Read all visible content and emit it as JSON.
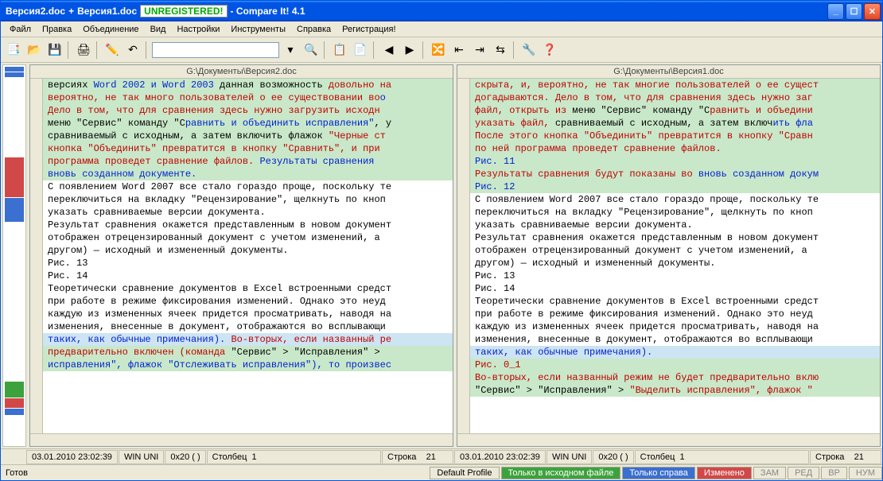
{
  "title": {
    "a": "Версия2.doc",
    "plus": "+",
    "b": "Версия1.doc",
    "dash": "- Compare It! 4.1",
    "unreg": "UNREGISTERED!"
  },
  "menu": [
    "Файл",
    "Правка",
    "Объединение",
    "Вид",
    "Настройки",
    "Инструменты",
    "Справка",
    "Регистрация!"
  ],
  "left": {
    "path": "G:\\Документы\\Версия2.doc",
    "lines": [
      {
        "cls": "bg-change",
        "spans": [
          {
            "c": "c-black",
            "t": "версиях "
          },
          {
            "c": "c-blue",
            "t": "Word 2002 и Word 2003 "
          },
          {
            "c": "c-black",
            "t": "данная возможность "
          },
          {
            "c": "c-red",
            "t": "довольно на"
          }
        ]
      },
      {
        "cls": "bg-change",
        "spans": [
          {
            "c": "c-red",
            "t": "вероятно, не так много пользователей о ее существовании во"
          },
          {
            "c": "c-blue",
            "t": "о"
          }
        ]
      },
      {
        "cls": "bg-change",
        "spans": [
          {
            "c": "c-red",
            "t": "Дело в том, что для сравнения здесь нужно загрузить исходн"
          }
        ]
      },
      {
        "cls": "bg-change",
        "spans": [
          {
            "c": "c-black",
            "t": "меню \"Сервис\" команду \"С"
          },
          {
            "c": "c-blue",
            "t": "равнить и объединить исправления\""
          },
          {
            "c": "c-black",
            "t": ", у"
          }
        ]
      },
      {
        "cls": "bg-change",
        "spans": [
          {
            "c": "c-black",
            "t": "сравниваемый с исходным, а затем включить флажок "
          },
          {
            "c": "c-red",
            "t": "\"Черные ст"
          }
        ]
      },
      {
        "cls": "bg-change",
        "spans": [
          {
            "c": "c-red",
            "t": "кнопка \"Объединить\" превратится в кнопку \"Сравнить\", и при "
          }
        ]
      },
      {
        "cls": "bg-change",
        "spans": [
          {
            "c": "c-red",
            "t": "программа проведет сравнение файлов. "
          },
          {
            "c": "c-blue",
            "t": " Результаты сравнения "
          }
        ]
      },
      {
        "cls": "bg-change",
        "spans": [
          {
            "c": "c-blue",
            "t": "вновь созданном документе."
          }
        ]
      },
      {
        "cls": "bg-del",
        "spans": [
          {
            "c": "c-black",
            "t": " "
          }
        ]
      },
      {
        "cls": "bg-del",
        "spans": [
          {
            "c": "c-black",
            "t": " "
          }
        ]
      },
      {
        "cls": "",
        "spans": [
          {
            "c": "c-black",
            "t": "С появлением Word 2007 все стало гораздо проще, поскольку те"
          }
        ]
      },
      {
        "cls": "",
        "spans": [
          {
            "c": "c-black",
            "t": "переключиться на вкладку \"Рецензирование\", щелкнуть по кноп"
          }
        ]
      },
      {
        "cls": "",
        "spans": [
          {
            "c": "c-black",
            "t": "указать сравниваемые версии документа."
          }
        ]
      },
      {
        "cls": "",
        "spans": [
          {
            "c": "c-black",
            "t": "Результат сравнения окажется представленным в новом документ"
          }
        ]
      },
      {
        "cls": "",
        "spans": [
          {
            "c": "c-black",
            "t": "отображен отрецензированный документ с учетом изменений, а "
          }
        ]
      },
      {
        "cls": "",
        "spans": [
          {
            "c": "c-black",
            "t": "другом) — исходный и измененный документы."
          }
        ]
      },
      {
        "cls": "",
        "spans": [
          {
            "c": "c-black",
            "t": "Рис. 13"
          }
        ]
      },
      {
        "cls": "",
        "spans": [
          {
            "c": "c-black",
            "t": "Рис. 14"
          }
        ]
      },
      {
        "cls": "",
        "spans": [
          {
            "c": "c-black",
            "t": "Теоретически сравнение документов в Excel встроенными средст"
          }
        ]
      },
      {
        "cls": "",
        "spans": [
          {
            "c": "c-black",
            "t": "при работе в режиме фиксирования изменений. Однако это неуд"
          }
        ]
      },
      {
        "cls": "",
        "spans": [
          {
            "c": "c-black",
            "t": "каждую из измененных ячеек придется просматривать, наводя на"
          }
        ]
      },
      {
        "cls": "",
        "spans": [
          {
            "c": "c-black",
            "t": "изменения, внесенные в документ, отображаются во всплывающи"
          }
        ]
      },
      {
        "cls": "bg-blue",
        "spans": [
          {
            "c": "c-blue",
            "t": "таких, как обычные примечания). "
          },
          {
            "c": "c-red",
            "t": "Во-вторых, если названный ре"
          }
        ]
      },
      {
        "cls": "bg-del",
        "spans": [
          {
            "c": "c-black",
            "t": " "
          }
        ]
      },
      {
        "cls": "bg-change",
        "spans": [
          {
            "c": "c-red",
            "t": "предварительно включен (команда "
          },
          {
            "c": "c-black",
            "t": "\"Сервис\" > \"Исправления\" > "
          }
        ]
      },
      {
        "cls": "bg-change",
        "spans": [
          {
            "c": "c-blue",
            "t": "исправления\", флажок \"Отслеживать исправления\"), то произвес"
          }
        ]
      }
    ]
  },
  "right": {
    "path": "G:\\Документы\\Версия1.doc",
    "lines": [
      {
        "cls": "bg-change",
        "spans": [
          {
            "c": "c-red",
            "t": "скрыта, и, вероятно, не так многие пользователей о ее сущест"
          }
        ]
      },
      {
        "cls": "bg-change",
        "spans": [
          {
            "c": "c-red",
            "t": "догадываются. Дело в том, что для сравнения здесь нужно заг"
          }
        ]
      },
      {
        "cls": "bg-change",
        "spans": [
          {
            "c": "c-red",
            "t": "файл, открыть из "
          },
          {
            "c": "c-black",
            "t": "меню \"Сервис\" команду \"С"
          },
          {
            "c": "c-red",
            "t": "равнить и объедини"
          }
        ]
      },
      {
        "cls": "bg-change",
        "spans": [
          {
            "c": "c-red",
            "t": "указать файл, "
          },
          {
            "c": "c-black",
            "t": "сравниваемый с исходным, а затем включ"
          },
          {
            "c": "c-blue",
            "t": "ить фла"
          }
        ]
      },
      {
        "cls": "bg-change",
        "spans": [
          {
            "c": "c-red",
            "t": "После этого кнопка \"Объединить\" превратится в кнопку \"Сравн"
          }
        ]
      },
      {
        "cls": "bg-change",
        "spans": [
          {
            "c": "c-red",
            "t": "по ней программа проведет сравнение файлов."
          }
        ]
      },
      {
        "cls": "bg-change",
        "spans": [
          {
            "c": "c-blue",
            "t": "Рис. 11"
          }
        ]
      },
      {
        "cls": "bg-change",
        "spans": [
          {
            "c": "c-red",
            "t": "Результаты сравнения будут показаны во "
          },
          {
            "c": "c-blue",
            "t": "вновь созданном докум"
          }
        ]
      },
      {
        "cls": "bg-change",
        "spans": [
          {
            "c": "c-blue",
            "t": "Рис. 12"
          }
        ]
      },
      {
        "cls": "",
        "spans": [
          {
            "c": "c-black",
            "t": "С появлением Word 2007 все стало гораздо проще, поскольку те"
          }
        ]
      },
      {
        "cls": "",
        "spans": [
          {
            "c": "c-black",
            "t": "переключиться на вкладку \"Рецензирование\", щелкнуть по кноп"
          }
        ]
      },
      {
        "cls": "",
        "spans": [
          {
            "c": "c-black",
            "t": "указать сравниваемые версии документа."
          }
        ]
      },
      {
        "cls": "",
        "spans": [
          {
            "c": "c-black",
            "t": "Результат сравнения окажется представленным в новом документ"
          }
        ]
      },
      {
        "cls": "",
        "spans": [
          {
            "c": "c-black",
            "t": "отображен отрецензированный документ с учетом изменений, а "
          }
        ]
      },
      {
        "cls": "",
        "spans": [
          {
            "c": "c-black",
            "t": "другом) — исходный и измененный документы."
          }
        ]
      },
      {
        "cls": "",
        "spans": [
          {
            "c": "c-black",
            "t": "Рис. 13"
          }
        ]
      },
      {
        "cls": "",
        "spans": [
          {
            "c": "c-black",
            "t": "Рис. 14"
          }
        ]
      },
      {
        "cls": "",
        "spans": [
          {
            "c": "c-black",
            "t": "Теоретически сравнение документов в Excel встроенными средст"
          }
        ]
      },
      {
        "cls": "",
        "spans": [
          {
            "c": "c-black",
            "t": "при работе в режиме фиксирования изменений. Однако это неуд"
          }
        ]
      },
      {
        "cls": "",
        "spans": [
          {
            "c": "c-black",
            "t": "каждую из измененных ячеек придется просматривать, наводя на"
          }
        ]
      },
      {
        "cls": "",
        "spans": [
          {
            "c": "c-black",
            "t": "изменения, внесенные в документ, отображаются во всплывающи"
          }
        ]
      },
      {
        "cls": "bg-blue",
        "spans": [
          {
            "c": "c-blue",
            "t": "таких, как обычные примечания)."
          }
        ]
      },
      {
        "cls": "bg-change",
        "spans": [
          {
            "c": "c-red",
            "t": "Рис. 0_1"
          }
        ]
      },
      {
        "cls": "bg-change",
        "spans": [
          {
            "c": "c-red",
            "t": "Во-вторых, если названный режим не будет предварительно вклю"
          }
        ]
      },
      {
        "cls": "bg-change",
        "spans": [
          {
            "c": "c-black",
            "t": "\"Сервис\" > \"Исправления\" > "
          },
          {
            "c": "c-red",
            "t": "\"Выделить исправления\", флажок \""
          }
        ]
      }
    ]
  },
  "status_panes": {
    "date": "03.01.2010  23:02:39",
    "enc": "WIN UNI",
    "hex": "0x20 ( )",
    "col_lbl": "Столбец",
    "col_val": "1",
    "row_lbl": "Строка",
    "row_val": "21"
  },
  "status2": {
    "ready": "Готов",
    "profile": "Default Profile",
    "only_src": "Только в исходном файле",
    "only_right": "Только справа",
    "changed": "Изменено",
    "zam": "ЗАМ",
    "red": "РЕД",
    "vp": "ВР",
    "num": "НУМ"
  }
}
